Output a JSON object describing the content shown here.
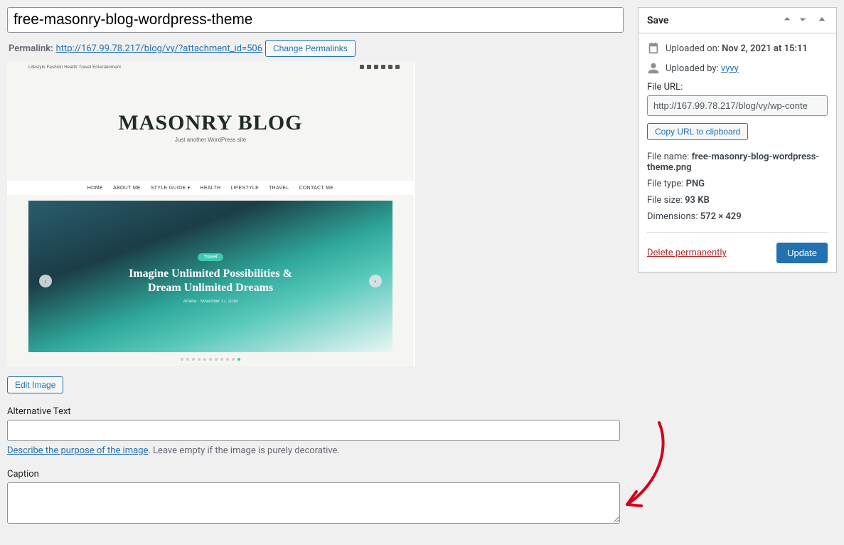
{
  "title_input": "free-masonry-blog-wordpress-theme",
  "permalink": {
    "label": "Permalink:",
    "url": "http://167.99.78.217/blog/vy/?attachment_id=506",
    "change_btn": "Change Permalinks"
  },
  "preview_theme": {
    "tags": "Lifestyle   Fashion   Health   Travel   Entertainment",
    "mast_title": "MASONRY BLOG",
    "mast_sub": "Just another WordPress site",
    "nav_items": [
      "HOME",
      "ABOUT ME",
      "STYLE GUIDE ▾",
      "HEALTH",
      "LIFESTYLE",
      "TRAVEL",
      "CONTACT ME"
    ],
    "hero_category": "Travel",
    "hero_title_line1": "Imagine Unlimited Possibilities &",
    "hero_title_line2": "Dream Unlimited Dreams",
    "hero_meta": "Amelia   ·   November 17, 2018"
  },
  "edit_image_btn": "Edit Image",
  "alt_text": {
    "label": "Alternative Text",
    "value": "",
    "helper_link": "Describe the purpose of the image",
    "helper_rest": ". Leave empty if the image is purely decorative."
  },
  "caption": {
    "label": "Caption",
    "value": ""
  },
  "save_box": {
    "title": "Save",
    "uploaded_on_label": "Uploaded on:",
    "uploaded_on_value": "Nov 2, 2021 at 15:11",
    "uploaded_by_label": "Uploaded by:",
    "uploaded_by_value": "vyvy",
    "file_url_label": "File URL:",
    "file_url_value": "http://167.99.78.217/blog/vy/wp-conte",
    "copy_btn": "Copy URL to clipboard",
    "file_name_label": "File name:",
    "file_name_value": "free-masonry-blog-wordpress-theme.png",
    "file_type_label": "File type:",
    "file_type_value": "PNG",
    "file_size_label": "File size:",
    "file_size_value": "93 KB",
    "dimensions_label": "Dimensions:",
    "dimensions_value": "572 × 429",
    "delete_label": "Delete permanently",
    "update_btn": "Update"
  }
}
